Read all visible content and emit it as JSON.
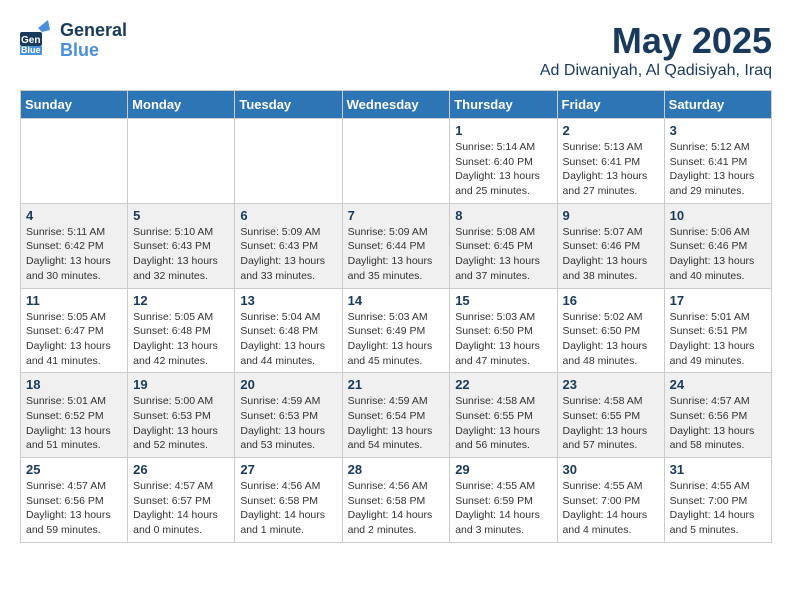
{
  "logo": {
    "general": "General",
    "blue": "Blue"
  },
  "header": {
    "month": "May 2025",
    "location": "Ad Diwaniyah, Al Qadisiyah, Iraq"
  },
  "weekdays": [
    "Sunday",
    "Monday",
    "Tuesday",
    "Wednesday",
    "Thursday",
    "Friday",
    "Saturday"
  ],
  "weeks": [
    [
      {
        "day": "",
        "info": ""
      },
      {
        "day": "",
        "info": ""
      },
      {
        "day": "",
        "info": ""
      },
      {
        "day": "",
        "info": ""
      },
      {
        "day": "1",
        "info": "Sunrise: 5:14 AM\nSunset: 6:40 PM\nDaylight: 13 hours\nand 25 minutes."
      },
      {
        "day": "2",
        "info": "Sunrise: 5:13 AM\nSunset: 6:41 PM\nDaylight: 13 hours\nand 27 minutes."
      },
      {
        "day": "3",
        "info": "Sunrise: 5:12 AM\nSunset: 6:41 PM\nDaylight: 13 hours\nand 29 minutes."
      }
    ],
    [
      {
        "day": "4",
        "info": "Sunrise: 5:11 AM\nSunset: 6:42 PM\nDaylight: 13 hours\nand 30 minutes."
      },
      {
        "day": "5",
        "info": "Sunrise: 5:10 AM\nSunset: 6:43 PM\nDaylight: 13 hours\nand 32 minutes."
      },
      {
        "day": "6",
        "info": "Sunrise: 5:09 AM\nSunset: 6:43 PM\nDaylight: 13 hours\nand 33 minutes."
      },
      {
        "day": "7",
        "info": "Sunrise: 5:09 AM\nSunset: 6:44 PM\nDaylight: 13 hours\nand 35 minutes."
      },
      {
        "day": "8",
        "info": "Sunrise: 5:08 AM\nSunset: 6:45 PM\nDaylight: 13 hours\nand 37 minutes."
      },
      {
        "day": "9",
        "info": "Sunrise: 5:07 AM\nSunset: 6:46 PM\nDaylight: 13 hours\nand 38 minutes."
      },
      {
        "day": "10",
        "info": "Sunrise: 5:06 AM\nSunset: 6:46 PM\nDaylight: 13 hours\nand 40 minutes."
      }
    ],
    [
      {
        "day": "11",
        "info": "Sunrise: 5:05 AM\nSunset: 6:47 PM\nDaylight: 13 hours\nand 41 minutes."
      },
      {
        "day": "12",
        "info": "Sunrise: 5:05 AM\nSunset: 6:48 PM\nDaylight: 13 hours\nand 42 minutes."
      },
      {
        "day": "13",
        "info": "Sunrise: 5:04 AM\nSunset: 6:48 PM\nDaylight: 13 hours\nand 44 minutes."
      },
      {
        "day": "14",
        "info": "Sunrise: 5:03 AM\nSunset: 6:49 PM\nDaylight: 13 hours\nand 45 minutes."
      },
      {
        "day": "15",
        "info": "Sunrise: 5:03 AM\nSunset: 6:50 PM\nDaylight: 13 hours\nand 47 minutes."
      },
      {
        "day": "16",
        "info": "Sunrise: 5:02 AM\nSunset: 6:50 PM\nDaylight: 13 hours\nand 48 minutes."
      },
      {
        "day": "17",
        "info": "Sunrise: 5:01 AM\nSunset: 6:51 PM\nDaylight: 13 hours\nand 49 minutes."
      }
    ],
    [
      {
        "day": "18",
        "info": "Sunrise: 5:01 AM\nSunset: 6:52 PM\nDaylight: 13 hours\nand 51 minutes."
      },
      {
        "day": "19",
        "info": "Sunrise: 5:00 AM\nSunset: 6:53 PM\nDaylight: 13 hours\nand 52 minutes."
      },
      {
        "day": "20",
        "info": "Sunrise: 4:59 AM\nSunset: 6:53 PM\nDaylight: 13 hours\nand 53 minutes."
      },
      {
        "day": "21",
        "info": "Sunrise: 4:59 AM\nSunset: 6:54 PM\nDaylight: 13 hours\nand 54 minutes."
      },
      {
        "day": "22",
        "info": "Sunrise: 4:58 AM\nSunset: 6:55 PM\nDaylight: 13 hours\nand 56 minutes."
      },
      {
        "day": "23",
        "info": "Sunrise: 4:58 AM\nSunset: 6:55 PM\nDaylight: 13 hours\nand 57 minutes."
      },
      {
        "day": "24",
        "info": "Sunrise: 4:57 AM\nSunset: 6:56 PM\nDaylight: 13 hours\nand 58 minutes."
      }
    ],
    [
      {
        "day": "25",
        "info": "Sunrise: 4:57 AM\nSunset: 6:56 PM\nDaylight: 13 hours\nand 59 minutes."
      },
      {
        "day": "26",
        "info": "Sunrise: 4:57 AM\nSunset: 6:57 PM\nDaylight: 14 hours\nand 0 minutes."
      },
      {
        "day": "27",
        "info": "Sunrise: 4:56 AM\nSunset: 6:58 PM\nDaylight: 14 hours\nand 1 minute."
      },
      {
        "day": "28",
        "info": "Sunrise: 4:56 AM\nSunset: 6:58 PM\nDaylight: 14 hours\nand 2 minutes."
      },
      {
        "day": "29",
        "info": "Sunrise: 4:55 AM\nSunset: 6:59 PM\nDaylight: 14 hours\nand 3 minutes."
      },
      {
        "day": "30",
        "info": "Sunrise: 4:55 AM\nSunset: 7:00 PM\nDaylight: 14 hours\nand 4 minutes."
      },
      {
        "day": "31",
        "info": "Sunrise: 4:55 AM\nSunset: 7:00 PM\nDaylight: 14 hours\nand 5 minutes."
      }
    ]
  ]
}
